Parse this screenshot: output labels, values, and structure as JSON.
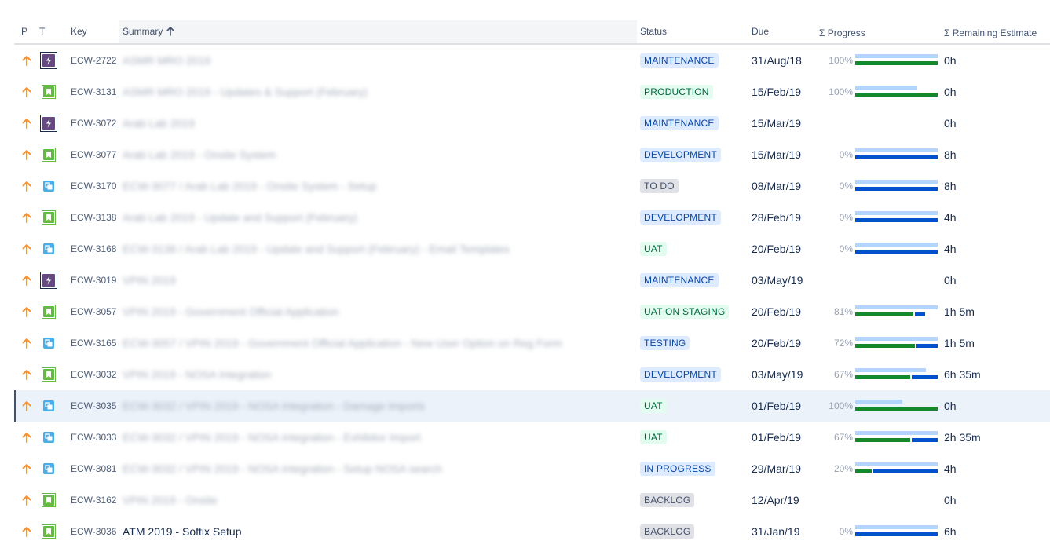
{
  "columns": {
    "p": "P",
    "t": "T",
    "key": "Key",
    "summary": "Summary",
    "status": "Status",
    "due": "Due",
    "progress": "Σ Progress",
    "remaining": "Σ Remaining Estimate"
  },
  "sort_arrow_icon": "arrow-up-icon",
  "colors": {
    "priority_arrow": "#f79232",
    "epic": "#654982",
    "story": "#65ba43",
    "subtask": "#4bade8",
    "progress_done": "#14892c",
    "progress_remaining": "#0052cc",
    "progress_estimate": "#b3d4ff"
  },
  "status_styles": {
    "MAINTENANCE": {
      "bg": "#deebff",
      "fg": "#0747a6"
    },
    "PRODUCTION": {
      "bg": "#e3fcef",
      "fg": "#006644"
    },
    "DEVELOPMENT": {
      "bg": "#deebff",
      "fg": "#0747a6"
    },
    "TO DO": {
      "bg": "#dfe1e6",
      "fg": "#42526e"
    },
    "UAT": {
      "bg": "#e3fcef",
      "fg": "#006644"
    },
    "UAT ON STAGING": {
      "bg": "#e3fcef",
      "fg": "#006644"
    },
    "TESTING": {
      "bg": "#deebff",
      "fg": "#0747a6"
    },
    "IN PROGRESS": {
      "bg": "#deebff",
      "fg": "#0747a6"
    },
    "BACKLOG": {
      "bg": "#dfe1e6",
      "fg": "#42526e"
    }
  },
  "rows": [
    {
      "type": "epic",
      "key": "ECW-2722",
      "summary": "ASMR MRO 2019",
      "blurred": true,
      "status": "MAINTENANCE",
      "due": "31/Aug/18",
      "progress": {
        "label": "100%",
        "estimate": 1.0,
        "done": 1.0
      },
      "remaining": "0h"
    },
    {
      "type": "story",
      "key": "ECW-3131",
      "summary": "ASMR MRO 2019 - Updates & Support (February)",
      "blurred": true,
      "status": "PRODUCTION",
      "due": "15/Feb/19",
      "progress": {
        "label": "100%",
        "estimate": 0.75,
        "done": 1.0
      },
      "remaining": "0h"
    },
    {
      "type": "epic",
      "key": "ECW-3072",
      "summary": "Arab Lab 2019",
      "blurred": true,
      "status": "MAINTENANCE",
      "due": "15/Mar/19",
      "progress": null,
      "remaining": "0h"
    },
    {
      "type": "story",
      "key": "ECW-3077",
      "summary": "Arab Lab 2019 - Onsite System",
      "blurred": true,
      "status": "DEVELOPMENT",
      "due": "15/Mar/19",
      "progress": {
        "label": "0%",
        "estimate": 1.0,
        "done": 0.0
      },
      "remaining": "8h"
    },
    {
      "type": "subtask",
      "key": "ECW-3170",
      "summary": "ECW-3077 / Arab Lab 2019 - Onsite System - Setup",
      "blurred": true,
      "status": "TO DO",
      "due": "08/Mar/19",
      "progress": {
        "label": "0%",
        "estimate": 1.0,
        "done": 0.0
      },
      "remaining": "8h"
    },
    {
      "type": "story",
      "key": "ECW-3138",
      "summary": "Arab Lab 2019 - Update and Support (February)",
      "blurred": true,
      "status": "DEVELOPMENT",
      "due": "28/Feb/19",
      "progress": {
        "label": "0%",
        "estimate": 1.0,
        "done": 0.0
      },
      "remaining": "4h"
    },
    {
      "type": "subtask",
      "key": "ECW-3168",
      "summary": "ECW-3138 / Arab Lab 2019 - Update and Support (February) - Email Templates",
      "blurred": true,
      "status": "UAT",
      "due": "20/Feb/19",
      "progress": {
        "label": "0%",
        "estimate": 1.0,
        "done": 0.0
      },
      "remaining": "4h"
    },
    {
      "type": "epic",
      "key": "ECW-3019",
      "summary": "VPIN 2019",
      "blurred": true,
      "status": "MAINTENANCE",
      "due": "03/May/19",
      "progress": null,
      "remaining": "0h"
    },
    {
      "type": "story",
      "key": "ECW-3057",
      "summary": "VPIN 2019 - Government Official Application",
      "blurred": true,
      "status": "UAT ON STAGING",
      "due": "20/Feb/19",
      "progress": {
        "label": "81%",
        "estimate": 1.0,
        "done": 0.7,
        "total": 0.85
      },
      "remaining": "1h 5m"
    },
    {
      "type": "subtask",
      "key": "ECW-3165",
      "summary": "ECW-3057 / VPIN 2019 - Government Official Application - New User Option on Reg Form",
      "blurred": true,
      "status": "TESTING",
      "due": "20/Feb/19",
      "progress": {
        "label": "72%",
        "estimate": 1.0,
        "done": 0.72
      },
      "remaining": "1h 5m"
    },
    {
      "type": "story",
      "key": "ECW-3032",
      "summary": "VPIN 2019 - NOSA Integration",
      "blurred": true,
      "status": "DEVELOPMENT",
      "due": "03/May/19",
      "progress": {
        "label": "67%",
        "estimate": 0.86,
        "done": 0.67
      },
      "remaining": "6h 35m"
    },
    {
      "type": "subtask",
      "key": "ECW-3035",
      "summary": "ECW-3032 / VPIN 2019 - NOSA Integration - Damage Imports",
      "blurred": true,
      "status": "UAT",
      "due": "01/Feb/19",
      "progress": {
        "label": "100%",
        "estimate": 0.57,
        "done": 1.0
      },
      "remaining": "0h",
      "selected": true
    },
    {
      "type": "subtask",
      "key": "ECW-3033",
      "summary": "ECW-3032 / VPIN 2019 - NOSA Integration - Exhibitor Import",
      "blurred": true,
      "status": "UAT",
      "due": "01/Feb/19",
      "progress": {
        "label": "67%",
        "estimate": 1.0,
        "done": 0.67
      },
      "remaining": "2h 35m"
    },
    {
      "type": "subtask",
      "key": "ECW-3081",
      "summary": "ECW-3032 / VPIN 2019 - NOSA Integration - Setup NOSA search",
      "blurred": true,
      "status": "IN PROGRESS",
      "due": "29/Mar/19",
      "progress": {
        "label": "20%",
        "estimate": 1.0,
        "done": 0.2
      },
      "remaining": "4h"
    },
    {
      "type": "story",
      "key": "ECW-3162",
      "summary": "VPIN 2019 - Onsite",
      "blurred": true,
      "status": "BACKLOG",
      "due": "12/Apr/19",
      "progress": null,
      "remaining": "0h"
    },
    {
      "type": "story",
      "key": "ECW-3036",
      "summary": "ATM 2019 - Softix Setup",
      "blurred": false,
      "status": "BACKLOG",
      "due": "31/Jan/19",
      "progress": {
        "label": "0%",
        "estimate": 1.0,
        "done": 0.0
      },
      "remaining": "6h"
    }
  ]
}
